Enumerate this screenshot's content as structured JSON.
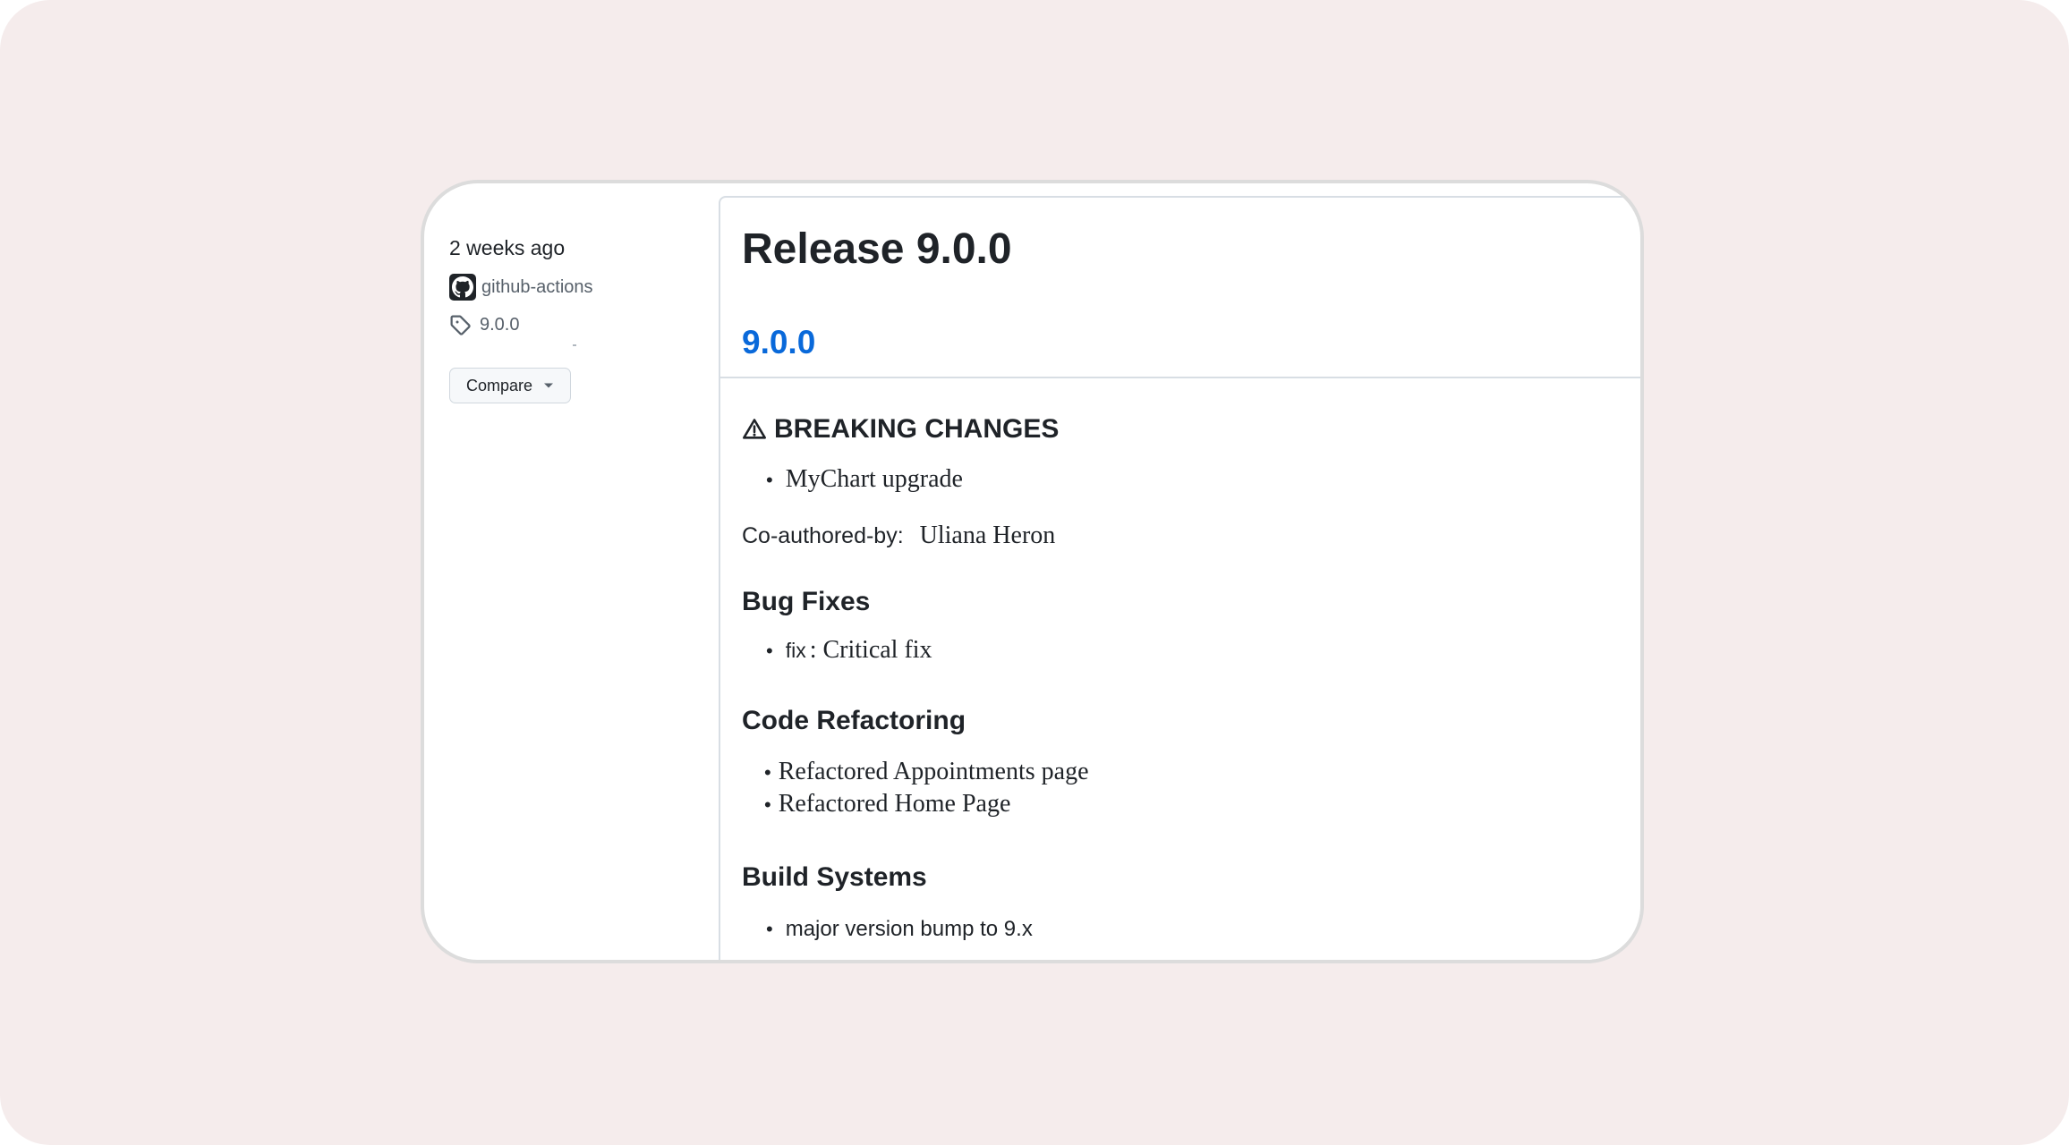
{
  "sidebar": {
    "time_ago": "2 weeks ago",
    "author": "github-actions",
    "tag": "9.0.0",
    "compare_label": "Compare"
  },
  "release": {
    "title": "Release 9.0.0",
    "version_link": "9.0.0",
    "sections": {
      "breaking": {
        "heading": "BREAKING CHANGES",
        "items": [
          "MyChart upgrade"
        ],
        "coauthor_label": "Co-authored-by:",
        "coauthor_name": "Uliana Heron"
      },
      "bugfixes": {
        "heading": "Bug Fixes",
        "item_prefix": "fix",
        "item_text": ": Critical fix"
      },
      "refactoring": {
        "heading": "Code Refactoring",
        "items": [
          "Refactored Appointments page",
          "Refactored Home Page"
        ]
      },
      "build": {
        "heading": "Build Systems",
        "items": [
          "major version bump to 9.x"
        ]
      }
    }
  },
  "colors": {
    "backdrop": "#f5ecec",
    "link": "#0969da",
    "text": "#1f2328",
    "muted": "#57606a"
  },
  "icons": {
    "avatar": "github-mark-icon",
    "tag": "tag-icon",
    "caret": "caret-down-icon",
    "warning": "alert-icon"
  }
}
